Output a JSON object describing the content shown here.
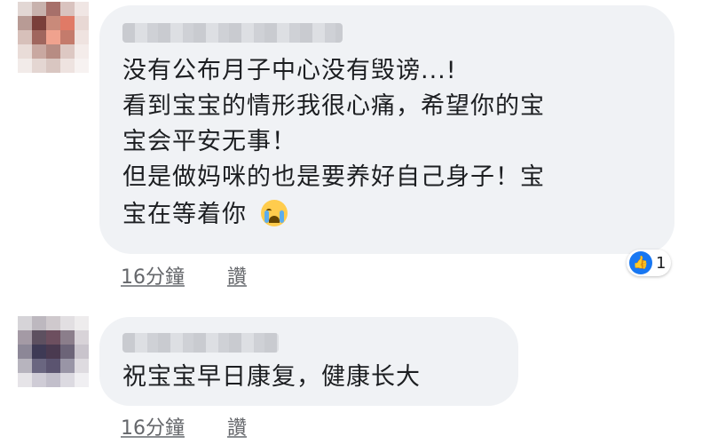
{
  "comments": [
    {
      "lines": [
        "没有公布月子中心没有毁谤...!",
        "看到宝宝的情形我很心痛，希望你的宝",
        "宝会平安无事！",
        "但是做妈咪的也是要养好自己身子！宝",
        "宝在等着你"
      ],
      "emoji": "loudly-crying-face",
      "time": "16分鐘",
      "like_label": "讚",
      "reaction_count": "1"
    },
    {
      "lines": [
        "祝宝宝早日康复，健康长大"
      ],
      "time": "16分鐘",
      "like_label": "讚"
    }
  ],
  "colors": {
    "bubble": "#f0f2f5",
    "like_blue": "#1877f2",
    "meta_gray": "#65676b"
  }
}
